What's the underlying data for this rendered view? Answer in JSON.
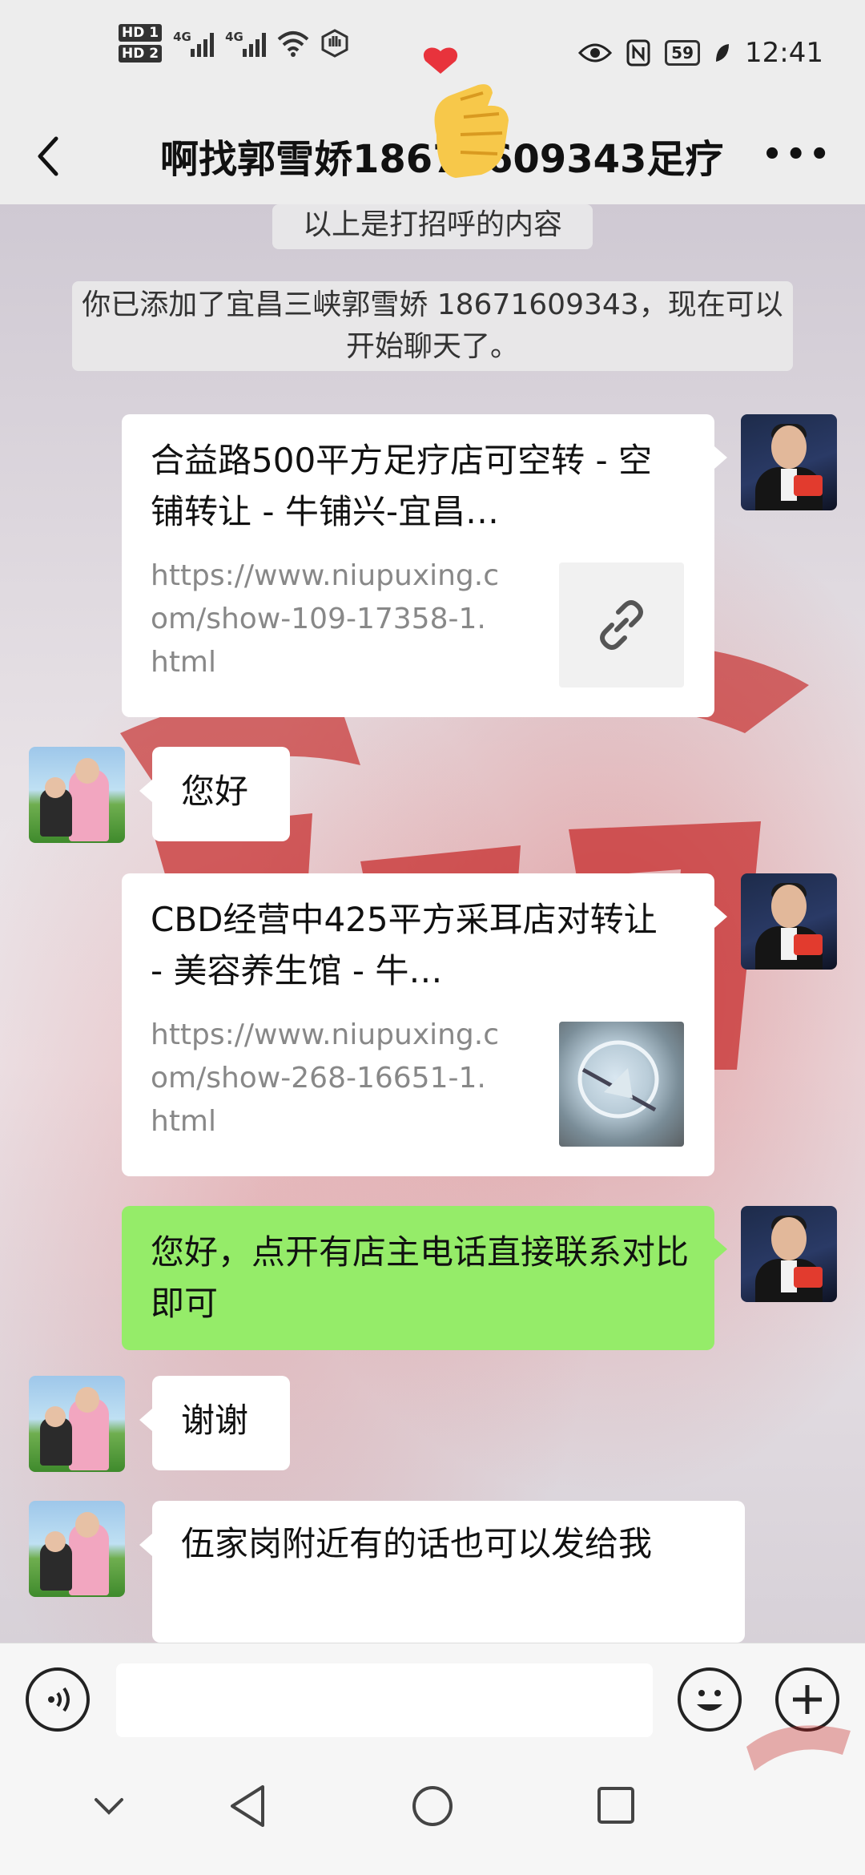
{
  "status_bar": {
    "hd1": "HD 1",
    "hd2": "HD 2",
    "net1": "4G",
    "net2": "4G",
    "battery": "59",
    "time": "12:41"
  },
  "header": {
    "title": "啊找郭雪娇18671609343足疗",
    "back_icon": "chevron-left-icon",
    "more_icon": "more-dots-icon"
  },
  "chat": {
    "system_messages": [
      "以上是打招呼的内容",
      "你已添加了宜昌三峡郭雪娇 18671609343，现在可以开始聊天了。"
    ],
    "messages": [
      {
        "side": "right",
        "type": "link_card",
        "title": "合益路500平方足疗店可空转 - 空铺转让 - 牛铺兴-宜昌…",
        "url": "https://www.niupuxing.com/show-109-17358-1.html",
        "thumb": "link-icon"
      },
      {
        "side": "left",
        "type": "text",
        "text": "您好"
      },
      {
        "side": "right",
        "type": "link_card",
        "title": "CBD经营中425平方采耳店对转让 - 美容养生馆 - 牛…",
        "url": "https://www.niupuxing.com/show-268-16651-1.html",
        "thumb": "image"
      },
      {
        "side": "right",
        "type": "text",
        "text": "您好，点开有店主电话直接联系对比即可"
      },
      {
        "side": "left",
        "type": "text",
        "text": "谢谢"
      },
      {
        "side": "left",
        "type": "text",
        "text": "伍家岗附近有的话也可以发给我"
      }
    ]
  },
  "input_bar": {
    "voice_icon": "voice-icon",
    "emoji_icon": "emoji-icon",
    "plus_icon": "plus-icon",
    "value": ""
  },
  "nav_bar": {
    "icons": [
      "chevron-down-icon",
      "back-triangle-icon",
      "home-circle-icon",
      "recents-square-icon"
    ]
  },
  "colors": {
    "bubble_green": "#95ec69",
    "bubble_white": "#ffffff",
    "bar_bg": "#ededed"
  }
}
